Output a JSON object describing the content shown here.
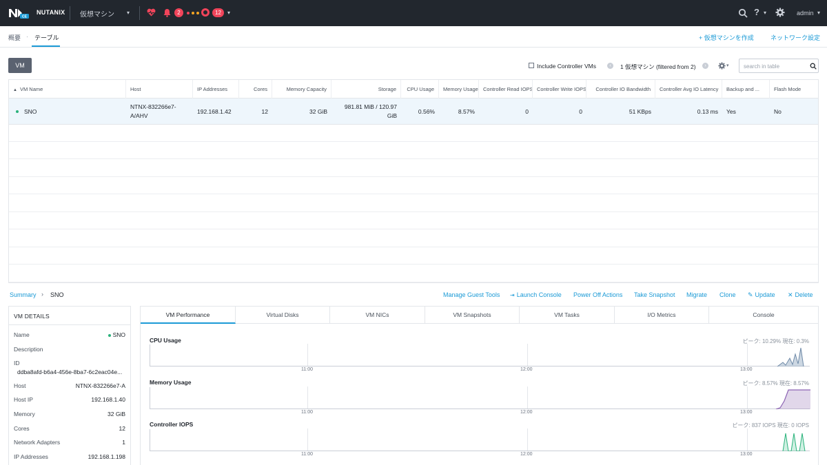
{
  "topbar": {
    "brand": "NUTANIX",
    "logo_badge": "CE",
    "menu_title": "仮想マシン",
    "alert_count": "2",
    "task_count": "12",
    "user": "admin",
    "dot_colors": [
      "#f0445a",
      "#f5a623",
      "#f5a623"
    ]
  },
  "subnav": {
    "overview": "概要",
    "separator": "·",
    "table": "テーブル",
    "create_vm": "+ 仮想マシンを作成",
    "network_settings": "ネットワーク設定"
  },
  "toolbar": {
    "vm_button": "VM",
    "include_controller": "Include Controller VMs",
    "count": "1 仮想マシン (filtered from 2)",
    "search_placeholder": "search in table"
  },
  "table": {
    "headers": [
      "VM Name",
      "Host",
      "IP Addresses",
      "Cores",
      "Memory Capacity",
      "Storage",
      "CPU Usage",
      "Memory Usage",
      "Controller Read IOPS",
      "Controller Write IOPS",
      "Controller IO Bandwidth",
      "Controller Avg IO Latency",
      "Backup and ...",
      "Flash Mode"
    ],
    "rows": [
      {
        "name": "SNO",
        "host": "NTNX-832266e7-A/AHV",
        "ip": "192.168.1.42",
        "cores": "12",
        "memory": "32 GiB",
        "storage": "981.81 MiB / 120.97 GiB",
        "cpu": "0.56%",
        "mem_usage": "8.57%",
        "read_iops": "0",
        "write_iops": "0",
        "bandwidth": "51 KBps",
        "latency": "0.13 ms",
        "backup": "Yes",
        "flash": "No"
      }
    ]
  },
  "breadcrumb": {
    "summary": "Summary",
    "arrow": "›",
    "vm": "SNO"
  },
  "actions": {
    "manage_guest_tools": "Manage Guest Tools",
    "launch_console": "Launch Console",
    "power_off": "Power Off Actions",
    "take_snapshot": "Take Snapshot",
    "migrate": "Migrate",
    "clone": "Clone",
    "update": "Update",
    "delete": "Delete"
  },
  "details": {
    "header": "VM DETAILS",
    "name_label": "Name",
    "name_value": "SNO",
    "description_label": "Description",
    "id_label": "ID",
    "id_value": "ddba8afd-b6a4-456e-8ba7-6c2eac04e...",
    "host_label": "Host",
    "host_value": "NTNX-832266e7-A",
    "hostip_label": "Host IP",
    "hostip_value": "192.168.1.40",
    "memory_label": "Memory",
    "memory_value": "32 GiB",
    "cores_label": "Cores",
    "cores_value": "12",
    "adapters_label": "Network Adapters",
    "adapters_value": "1",
    "ips_label": "IP Addresses",
    "ips_value": "192.168.1.198"
  },
  "tabs": [
    "VM Performance",
    "Virtual Disks",
    "VM NICs",
    "VM Snapshots",
    "VM Tasks",
    "I/O Metrics",
    "Console"
  ],
  "charts": [
    {
      "title": "CPU Usage",
      "meta": "ピーク: 10.29%  現在: 0.3%",
      "color": "#8fa6bf"
    },
    {
      "title": "Memory Usage",
      "meta": "ピーク: 8.57%  現在: 8.57%",
      "color": "#a98bc4"
    },
    {
      "title": "Controller IOPS",
      "meta": "ピーク: 837 IOPS  現在: 0 IOPS",
      "color": "#3ec48a"
    }
  ],
  "time_ticks": [
    "11:00",
    "12:00",
    "13:00"
  ],
  "colors": {
    "accent": "#1b9ad6",
    "topbar": "#22272e",
    "badge": "#f0445a",
    "status_green": "#2ab27b"
  }
}
